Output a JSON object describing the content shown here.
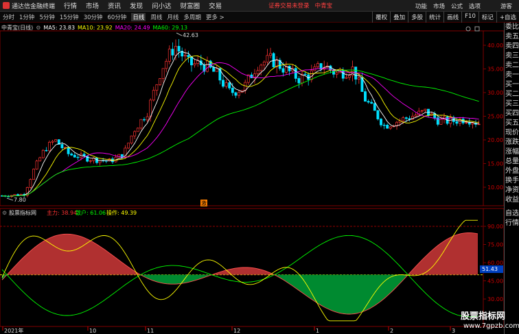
{
  "app": {
    "name": "通达信金融终端",
    "menu": [
      "行情",
      "市场",
      "资讯",
      "发现",
      "问小达",
      "财富圈",
      "交易"
    ],
    "notice": "证券交易未登录",
    "stock_link": "中青宝",
    "right_menu": [
      "功能",
      "市场",
      "公式",
      "选项"
    ],
    "guest": "游客"
  },
  "periods": [
    "分时",
    "1分钟",
    "5分钟",
    "15分钟",
    "30分钟",
    "60分钟",
    "日线",
    "周线",
    "月线",
    "多周期",
    "更多 >"
  ],
  "active_period": "日线",
  "tools": [
    "覆权",
    "叠加",
    "多股",
    "统计",
    "画线",
    "F10",
    "标记",
    "+自选"
  ],
  "main_header": {
    "title": "中青宝(日线)",
    "ma5": "MA5: 23.83",
    "ma10": "MA10: 23.92",
    "ma20": "MA20: 24.49",
    "ma60": "MA60: 29.13"
  },
  "price_labels": {
    "high": "42.63",
    "low": "7.80",
    "marker": "激"
  },
  "price_axis": [
    "40.00",
    "35.00",
    "30.00",
    "25.00",
    "20.00",
    "15.00",
    "10.00"
  ],
  "indicator_header": {
    "title": "股票指标网",
    "zhuli": "主力: 38.94",
    "sanhu": "散户: 61.06",
    "caozuo": "操作: 49.39"
  },
  "indicator_axis": [
    "90.00",
    "75.00",
    "60.00",
    "45.00",
    "30.00"
  ],
  "cursor_value": "51.43",
  "date_axis": [
    "2021年",
    "10",
    "11",
    "12",
    "1",
    "2",
    "3"
  ],
  "side_panel": [
    "委比",
    "卖五",
    "卖四",
    "卖三",
    "卖二",
    "卖一",
    "买一",
    "买二",
    "买三",
    "买四",
    "买五",
    "现价",
    "涨跌",
    "涨幅",
    "总量",
    "外盘",
    "换手",
    "净资",
    "收益"
  ],
  "side_panel_bottom": [
    "自选",
    "行情"
  ],
  "watermark": {
    "line1": "股票指标网",
    "line2": "www.7gpzb.com"
  },
  "colors": {
    "up": "#ff3232",
    "down": "#00e0ff",
    "ma5": "#ffffff",
    "ma10": "#ffff00",
    "ma20": "#ff00ff",
    "ma60": "#00ff00",
    "zhuli": "#ff3232",
    "sanhu": "#00ff00",
    "caozuo": "#ffff00"
  }
}
